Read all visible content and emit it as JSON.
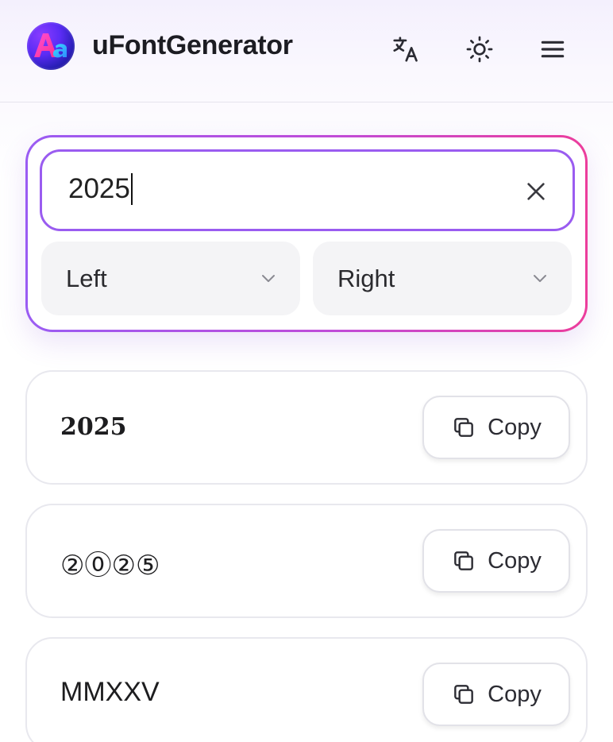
{
  "app": {
    "title": "uFontGenerator"
  },
  "header": {
    "icons": [
      "translate-icon",
      "sun-icon",
      "menu-icon"
    ]
  },
  "input": {
    "value": "2025",
    "align_left": "Left",
    "align_right": "Right"
  },
  "results": [
    {
      "text": "2025",
      "copy_label": "Copy"
    },
    {
      "text": "②⓪②⑤",
      "copy_label": "Copy"
    },
    {
      "text": "MMXXV",
      "copy_label": "Copy"
    }
  ],
  "colors": {
    "accent_start": "#9a5cf3",
    "accent_end": "#ec3d9c",
    "logo": "#5b2cf5"
  }
}
